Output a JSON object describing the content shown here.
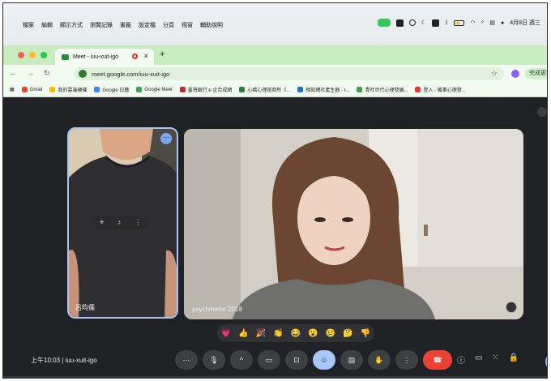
{
  "menubar": {
    "menus": [
      "檔案",
      "編輯",
      "顯示方式",
      "瀏覽記錄",
      "書籤",
      "設定檔",
      "分頁",
      "視窗",
      "輔助說明"
    ],
    "date": "4月8日 週三"
  },
  "browser": {
    "tab_title": "Meet - iuu-xuit-igo",
    "close": "×",
    "new_tab": "+",
    "url": "meet.google.com/iuu-xuit-igo",
    "finish_update": "完成更新",
    "bookmarks": [
      {
        "label": "Gmail",
        "color": "#ea4335"
      },
      {
        "label": "我的雲端硬碟",
        "color": "#fbbc04"
      },
      {
        "label": "Google 日曆",
        "color": "#4285f4"
      },
      {
        "label": "Google Meet",
        "color": "#34a853"
      },
      {
        "label": "臺灣銀行 e 企合成網",
        "color": "#c62828"
      },
      {
        "label": "心橋心理諮商所《...",
        "color": "#2e7d32"
      },
      {
        "label": "相知網社產生器 - r...",
        "color": "#1976d2"
      },
      {
        "label": "青社世代心理發展...",
        "color": "#43a047"
      },
      {
        "label": "登入 - 循軍心理發...",
        "color": "#e53935"
      }
    ]
  },
  "meet": {
    "participant_small": "呂昀儒",
    "participant_big": "psychmirror 2018",
    "time": "上午10:03",
    "separator": "|",
    "meeting_code": "iuu-xuit-igo",
    "reactions": [
      "💗",
      "👍",
      "🎉",
      "👏",
      "😂",
      "😮",
      "😢",
      "🤔",
      "👎"
    ]
  }
}
